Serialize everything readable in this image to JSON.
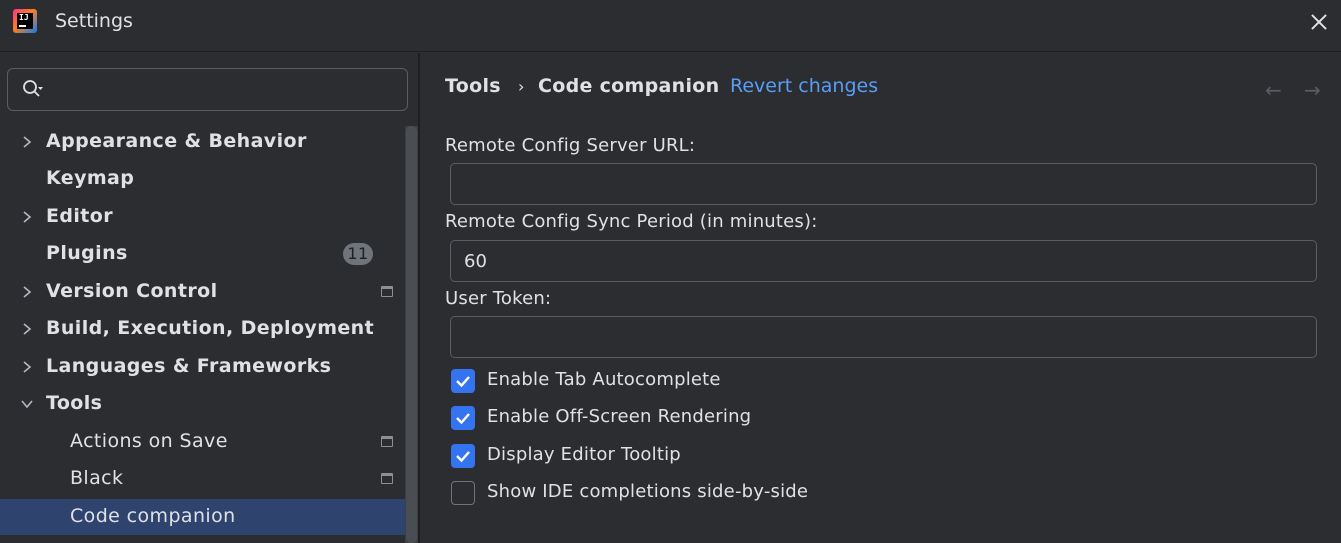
{
  "window": {
    "title": "Settings",
    "app_icon": "intellij-logo-icon",
    "app_icon_text": "IJ"
  },
  "search": {
    "placeholder": "",
    "value": ""
  },
  "sidebar": {
    "items": [
      {
        "label": "Appearance & Behavior",
        "expandable": true,
        "expanded": false
      },
      {
        "label": "Keymap",
        "expandable": false
      },
      {
        "label": "Editor",
        "expandable": true,
        "expanded": false
      },
      {
        "label": "Plugins",
        "expandable": false,
        "badge": "11"
      },
      {
        "label": "Version Control",
        "expandable": true,
        "expanded": false,
        "project_icon": true
      },
      {
        "label": "Build, Execution, Deployment",
        "expandable": true,
        "expanded": false
      },
      {
        "label": "Languages & Frameworks",
        "expandable": true,
        "expanded": false
      },
      {
        "label": "Tools",
        "expandable": true,
        "expanded": true
      },
      {
        "label": "Actions on Save",
        "child": true,
        "project_icon": true
      },
      {
        "label": "Black",
        "child": true,
        "project_icon": true
      },
      {
        "label": "Code companion",
        "child": true,
        "selected": true
      }
    ]
  },
  "breadcrumb": {
    "parent": "Tools",
    "separator": "›",
    "current": "Code companion",
    "revert_label": "Revert changes"
  },
  "form": {
    "url_label": "Remote Config Server URL:",
    "url_value": "",
    "sync_label": "Remote Config Sync Period (in minutes):",
    "sync_value": "60",
    "token_label": "User Token:",
    "token_value": "",
    "checkboxes": [
      {
        "label": "Enable Tab Autocomplete",
        "checked": true
      },
      {
        "label": "Enable Off-Screen Rendering",
        "checked": true
      },
      {
        "label": "Display Editor Tooltip",
        "checked": true
      },
      {
        "label": "Show IDE completions side-by-side",
        "checked": false
      }
    ]
  },
  "colors": {
    "accent": "#3574f0",
    "link": "#589df6",
    "selection": "#2e436e",
    "background": "#2b2d30"
  }
}
